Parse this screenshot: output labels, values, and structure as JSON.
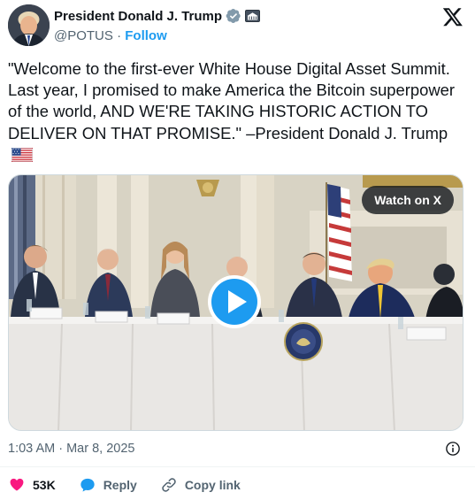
{
  "author": {
    "display_name": "President Donald J. Trump",
    "handle": "@POTUS",
    "separator": "·",
    "follow_label": "Follow"
  },
  "tweet": {
    "text": "\"Welcome to the first-ever White House Digital Asset Summit. Last year, I promised to make America the Bitcoin superpower of the world, AND WE'RE TAKING HISTORIC ACTION TO DELIVER ON THAT PROMISE.\" –President Donald J. Trump",
    "flag_emoji": "us-flag"
  },
  "media": {
    "watch_label": "Watch on X",
    "type": "video"
  },
  "meta": {
    "timestamp": "1:03 AM · Mar 8, 2025"
  },
  "actions": {
    "likes_count": "53K",
    "reply_label": "Reply",
    "copy_link_label": "Copy link"
  },
  "colors": {
    "accent": "#1d9bf0",
    "like": "#f91880",
    "verified_badge": "#829aab",
    "text": "#0f1419",
    "muted": "#536471"
  },
  "icons": [
    "verified-badge-icon",
    "government-affiliation-icon",
    "x-logo-icon",
    "play-icon",
    "info-icon",
    "heart-icon",
    "reply-icon",
    "link-icon"
  ]
}
